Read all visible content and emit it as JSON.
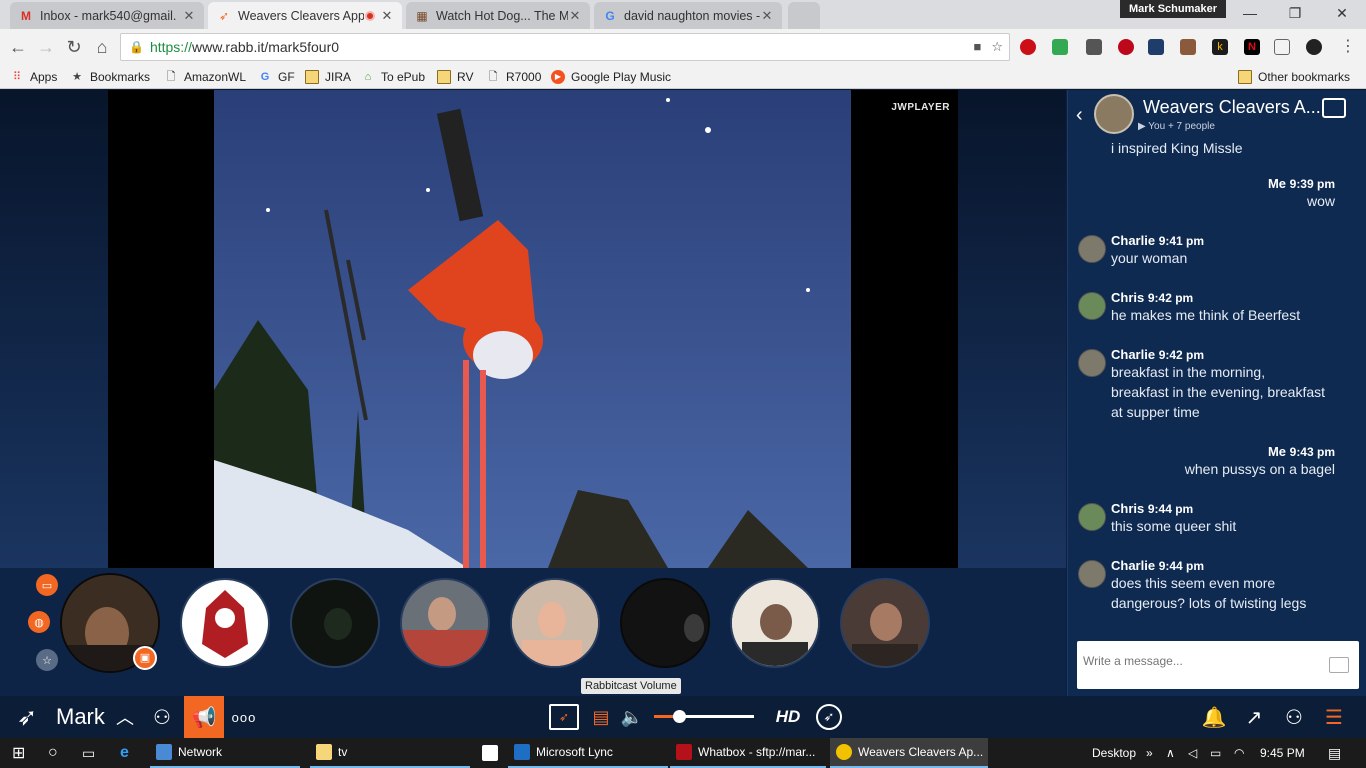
{
  "browser": {
    "profile_name": "Mark Schumaker",
    "tabs": [
      {
        "title": "Inbox - mark540@gmail.",
        "icon": "gmail-icon",
        "active": false
      },
      {
        "title": "Weavers Cleavers App",
        "icon": "rabbit-icon",
        "active": true
      },
      {
        "title": "Watch Hot Dog... The Mo",
        "icon": "film-icon",
        "active": false
      },
      {
        "title": "david naughton movies -",
        "icon": "google-icon",
        "active": false
      }
    ],
    "url": {
      "scheme": "https://",
      "rest": "www.rabb.it/mark5four0"
    },
    "bookmarks": [
      {
        "label": "Apps",
        "icon": "apps-grid-icon"
      },
      {
        "label": "Bookmarks",
        "icon": "star-icon"
      },
      {
        "label": "AmazonWL",
        "icon": "page-icon"
      },
      {
        "label": "GF",
        "icon": "google-icon"
      },
      {
        "label": "JIRA",
        "icon": "folder-icon"
      },
      {
        "label": "To ePub",
        "icon": "epub-icon"
      },
      {
        "label": "RV",
        "icon": "folder-icon"
      },
      {
        "label": "R7000",
        "icon": "page-icon"
      },
      {
        "label": "Google Play Music",
        "icon": "play-music-icon"
      }
    ],
    "other_bookmarks": "Other bookmarks"
  },
  "player": {
    "brand": "JWPLAYER"
  },
  "chat": {
    "title": "Weavers Cleavers A...",
    "subtitle": "▶ You + 7 people",
    "first_line": "i inspired King Missle",
    "messages": [
      {
        "from": "Me",
        "time": "9:39 pm",
        "lines": [
          "wow"
        ],
        "me": true
      },
      {
        "from": "Charlie",
        "time": "9:41 pm",
        "lines": [
          "your woman"
        ],
        "me": false
      },
      {
        "from": "Chris",
        "time": "9:42 pm",
        "lines": [
          "he makes me think of Beerfest"
        ],
        "me": false
      },
      {
        "from": "Charlie",
        "time": "9:42 pm",
        "lines": [
          "breakfast in the morning,",
          "breakfast in the evening, breakfast",
          "at supper time"
        ],
        "me": false
      },
      {
        "from": "Me",
        "time": "9:43 pm",
        "lines": [
          "when pussys on a bagel"
        ],
        "me": true
      },
      {
        "from": "Chris",
        "time": "9:44 pm",
        "lines": [
          "this some queer shit"
        ],
        "me": false
      },
      {
        "from": "Charlie",
        "time": "9:44 pm",
        "lines": [
          "does this seem even more",
          "dangerous? lots of twisting legs"
        ],
        "me": false
      }
    ],
    "input_placeholder": "Write a message..."
  },
  "bottombar": {
    "user_name": "Mark",
    "more_label": "ooo",
    "hd_label": "HD",
    "volume_tooltip": "Rabbitcast Volume",
    "volume_level": 0.25
  },
  "taskbar": {
    "items": [
      {
        "label": "Network",
        "icon": "network-icon"
      },
      {
        "label": "tv",
        "icon": "folder-icon"
      },
      {
        "label": "Microsoft Lync",
        "icon": "lync-icon"
      },
      {
        "label": "Whatbox - sftp://mar...",
        "icon": "filezilla-icon"
      },
      {
        "label": "Weavers Cleavers Ap...",
        "icon": "chrome-icon"
      }
    ],
    "desktop_label": "Desktop",
    "clock": "9:45 PM"
  },
  "colors": {
    "accent": "#f26722",
    "app_bg": "#0d1f3c",
    "chat_bg": "#0f2a50"
  }
}
